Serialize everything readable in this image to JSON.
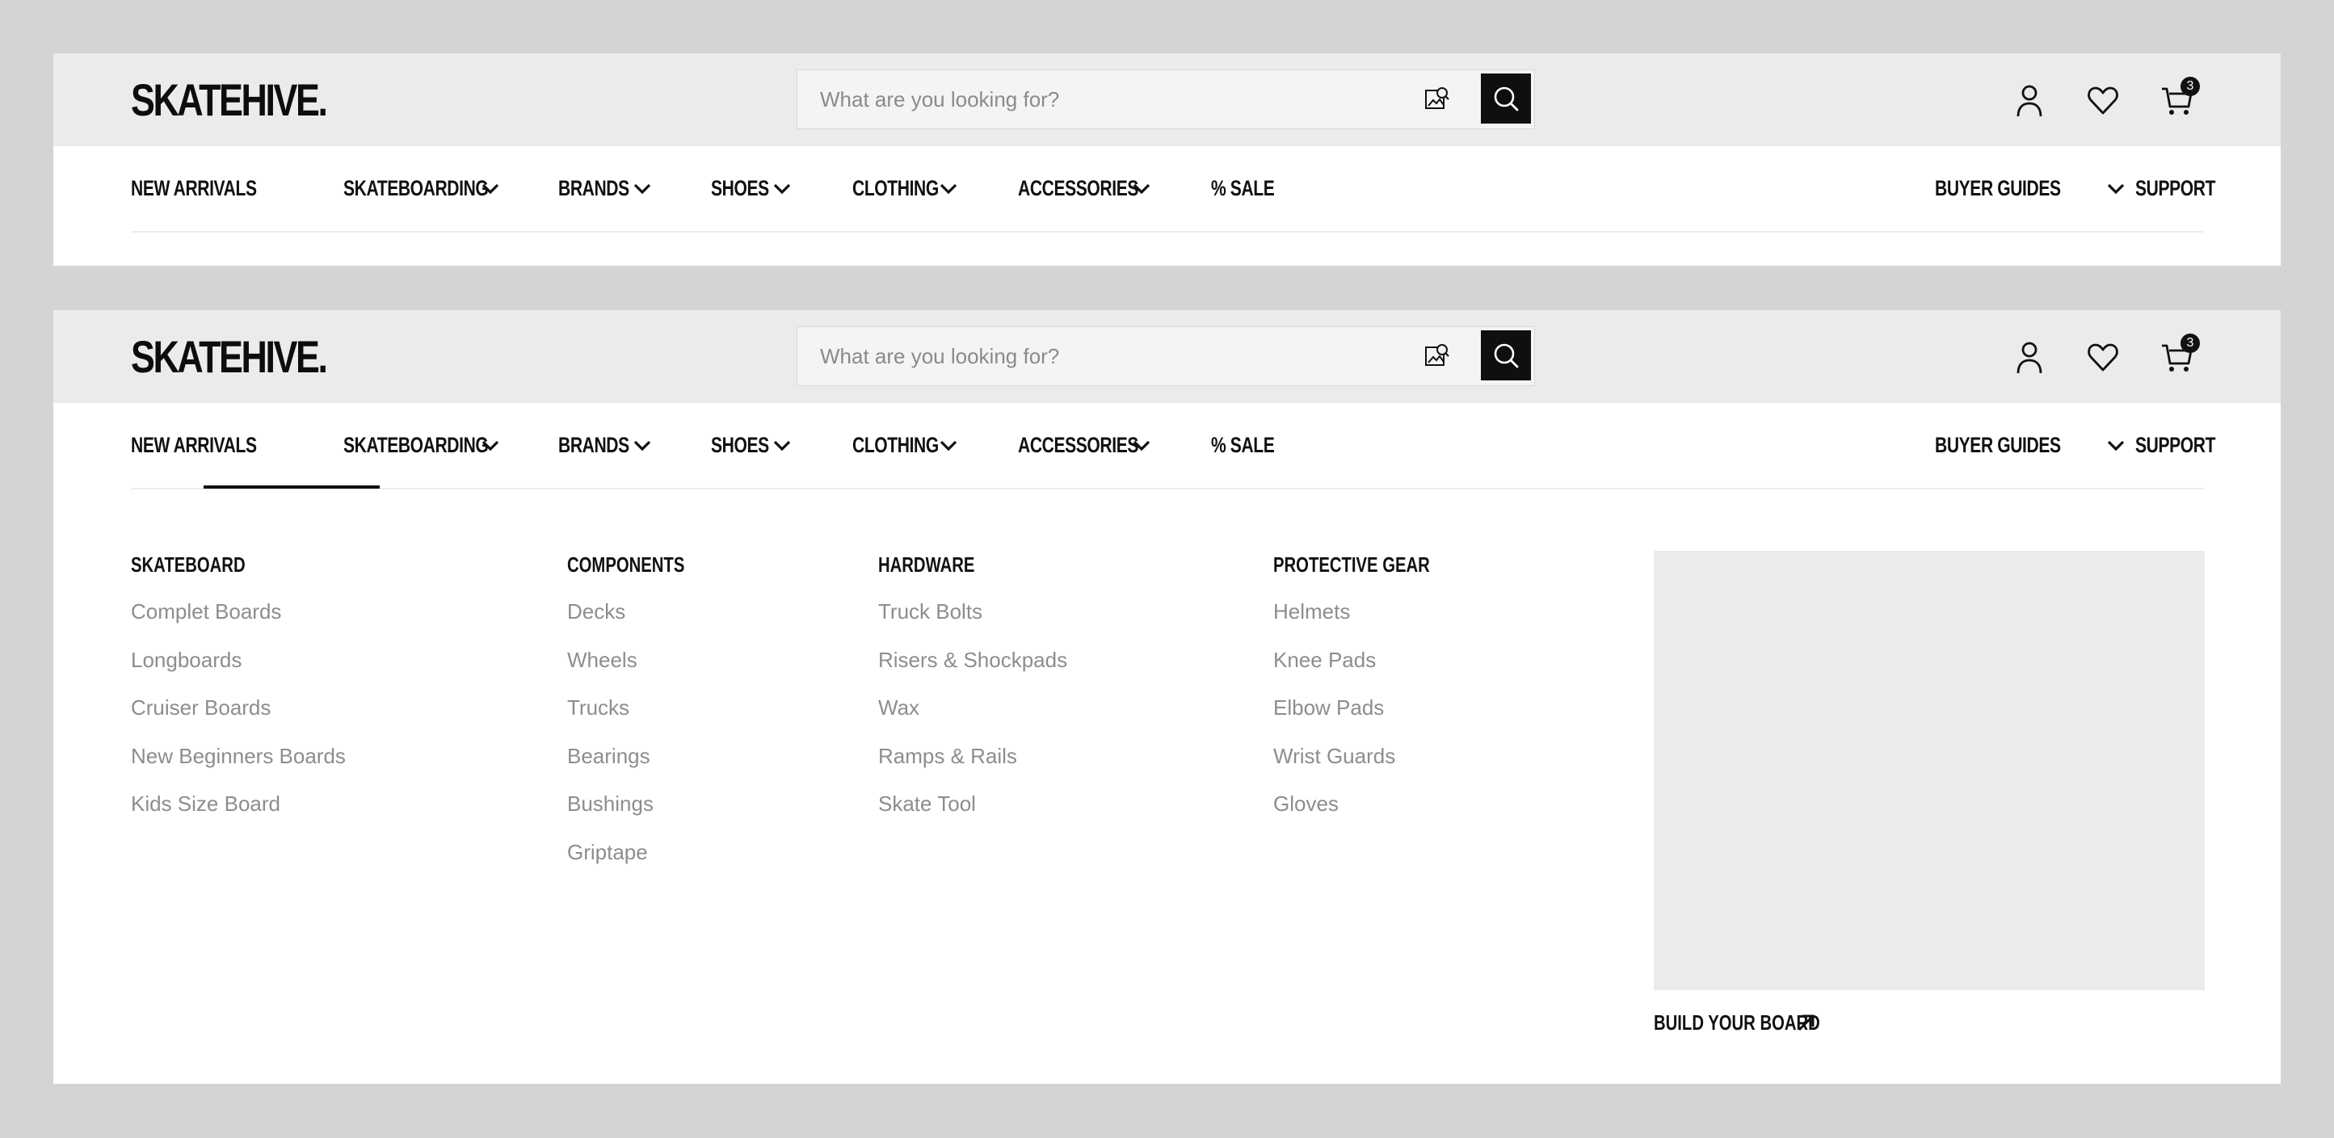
{
  "brand": {
    "logo": "SKATEHIVE."
  },
  "search": {
    "placeholder": "What are you looking for?"
  },
  "header": {
    "cart_count": "3"
  },
  "nav": {
    "items": [
      "NEW ARRIVALS",
      "SKATEBOARDING",
      "BRANDS",
      "SHOES",
      "CLOTHING",
      "ACCESSORIES",
      "% SALE"
    ],
    "right_items": [
      "BUYER GUIDES",
      "SUPPORT"
    ],
    "active": "SKATEBOARDING"
  },
  "mega_menu": {
    "columns": [
      {
        "title": "SKATEBOARD",
        "links": [
          "Complet Boards",
          "Longboards",
          "Cruiser Boards",
          "New Beginners Boards",
          "Kids Size Board"
        ]
      },
      {
        "title": "COMPONENTS",
        "links": [
          "Decks",
          "Wheels",
          "Trucks",
          "Bearings",
          "Bushings",
          "Griptape"
        ]
      },
      {
        "title": "HARDWARE",
        "links": [
          "Truck Bolts",
          "Risers & Shockpads",
          "Wax",
          "Ramps & Rails",
          "Skate Tool"
        ]
      },
      {
        "title": "PROTECTIVE GEAR",
        "links": [
          "Helmets",
          "Knee Pads",
          "Elbow Pads",
          "Wrist Guards",
          "Gloves"
        ]
      }
    ],
    "promo_link": "BUILD YOUR BOARD"
  },
  "icons": [
    "image-search-icon",
    "search-icon",
    "user-icon",
    "heart-icon",
    "cart-icon",
    "chevron-down-icon",
    "arrow-up-right-icon"
  ],
  "colors": {
    "accent": "#0f0f0f",
    "header_bg": "#ebebeb",
    "page_bg": "#d4d4d4",
    "link_muted": "#8d8d8d"
  }
}
